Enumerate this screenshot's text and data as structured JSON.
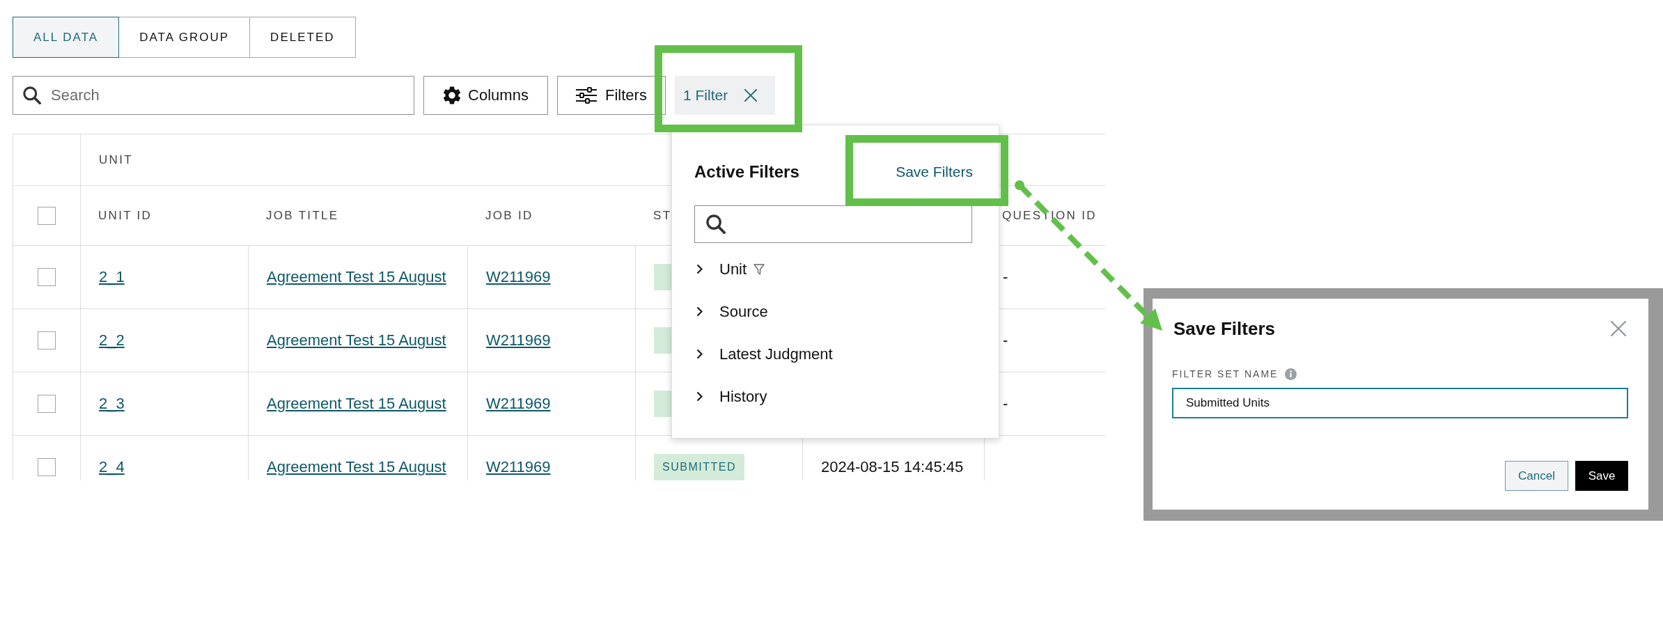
{
  "tabs": [
    {
      "label": "ALL DATA",
      "selected": true
    },
    {
      "label": "DATA GROUP",
      "selected": false
    },
    {
      "label": "DELETED",
      "selected": false
    }
  ],
  "toolbar": {
    "search": {
      "placeholder": "Search"
    },
    "columns_button": "Columns",
    "filters_button": "Filters",
    "filter_chip": "1 Filter"
  },
  "table": {
    "group_header": "UNIT",
    "select_all": {
      "checked": false
    },
    "columns": [
      "UNIT ID",
      "JOB TITLE",
      "JOB ID",
      "ST",
      "QUESTION ID"
    ],
    "rows": [
      {
        "checked": false,
        "unit_id": "2_1",
        "job_title": "Agreement Test 15 August",
        "job_id": "W211969",
        "badge": true,
        "question_id": "-"
      },
      {
        "checked": false,
        "unit_id": "2_2",
        "job_title": "Agreement Test 15 August",
        "job_id": "W211969",
        "badge": true,
        "question_id": "-"
      },
      {
        "checked": false,
        "unit_id": "2_3",
        "job_title": "Agreement Test 15 August",
        "job_id": "W211969",
        "badge": true,
        "question_id": "-"
      },
      {
        "checked": false,
        "unit_id": "2_4",
        "job_title": "Agreement Test 15 August",
        "job_id": "W211969",
        "badge": true,
        "status": "SUBMITTED",
        "time": "2024-08-15 14:45:45"
      }
    ]
  },
  "filter_menu": {
    "title": "Active Filters",
    "save_link": "Save Filters",
    "items": [
      {
        "label": "Unit",
        "expanded": false,
        "filtered": true
      },
      {
        "label": "Source",
        "expanded": false,
        "filtered": false
      },
      {
        "label": "Latest Judgment",
        "expanded": false,
        "filtered": false
      },
      {
        "label": "History",
        "expanded": false,
        "filtered": false
      }
    ]
  },
  "save_dialog": {
    "title": "Save Filters",
    "field": {
      "label": "FILTER SET NAME",
      "value": "Submitted Units",
      "focused": true
    },
    "buttons": [
      {
        "label": "Cancel",
        "kind": "secondary"
      },
      {
        "label": "Save",
        "kind": "primary"
      }
    ]
  }
}
